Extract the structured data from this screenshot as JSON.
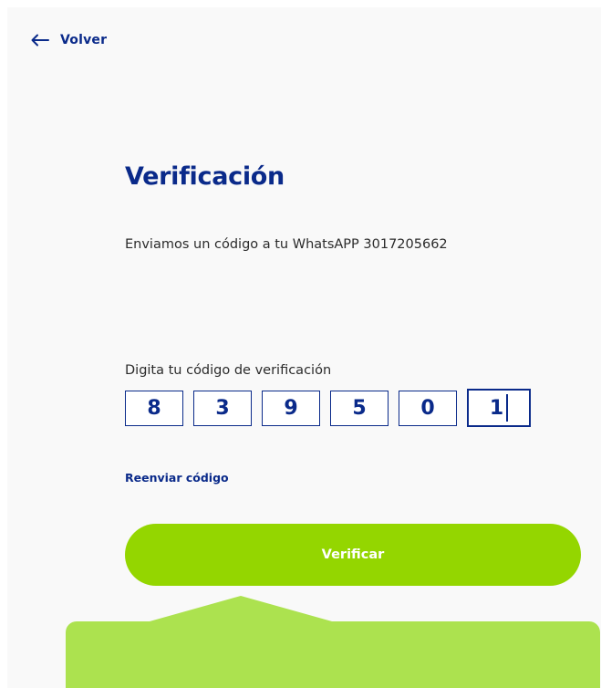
{
  "header": {
    "back_label": "Volver"
  },
  "main": {
    "title": "Verificación",
    "subtitle": "Enviamos un código a tu WhatsAPP 3017205662",
    "code_label": "Digita tu código de verificación",
    "code_digits": [
      "8",
      "3",
      "9",
      "5",
      "0",
      "1"
    ],
    "active_digit_index": 5,
    "resend_label": "Reenviar código",
    "verify_label": "Verificar"
  },
  "colors": {
    "primary_blue": "#0a2a8a",
    "accent_green": "#94d600",
    "tooltip_green": "#ace24f"
  },
  "icons": {
    "back": "arrow-left-icon"
  }
}
